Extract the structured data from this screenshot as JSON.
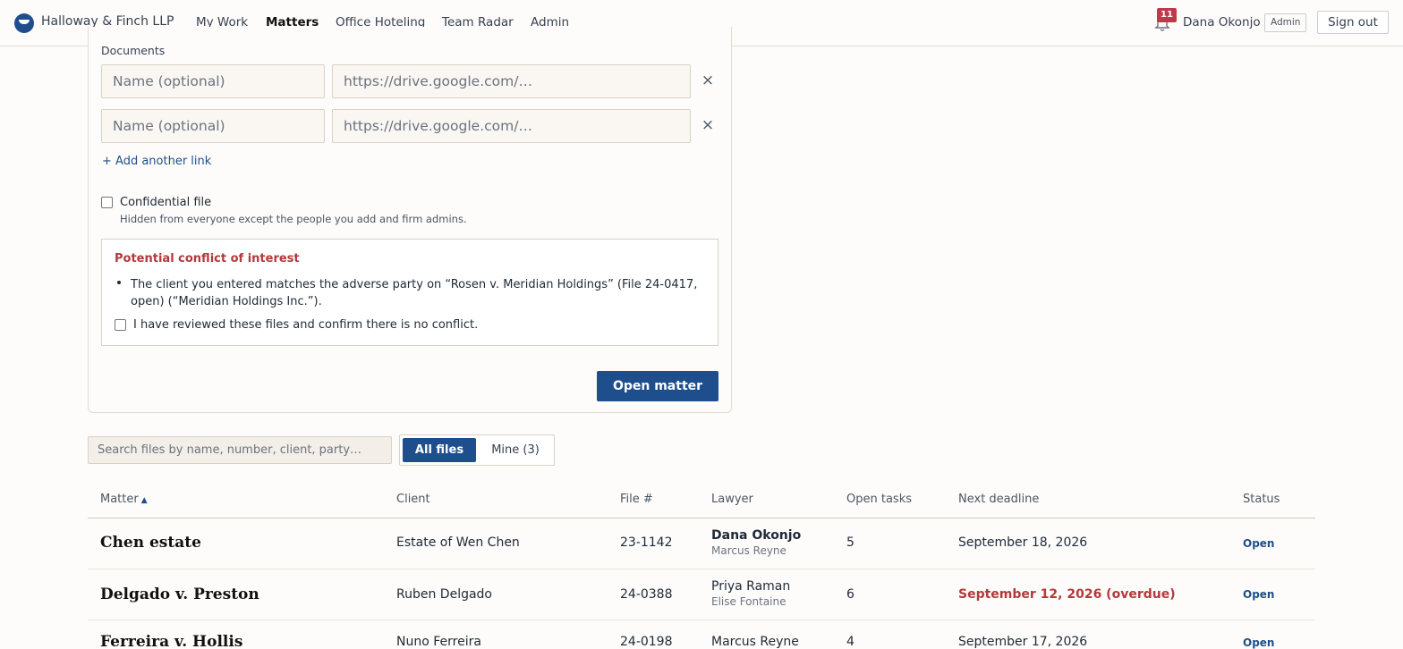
{
  "app": {
    "brand": "Halloway & Finch LLP",
    "nav": [
      "My Work",
      "Matters",
      "Office Hoteling",
      "Team Radar",
      "Admin"
    ],
    "active_nav": "Matters",
    "notifications_count": "11",
    "user_name": "Dana Okonjo",
    "user_role": "Admin",
    "sign_out": "Sign out"
  },
  "form": {
    "documents_label": "Documents",
    "doc_rows": [
      {
        "name_placeholder": "Name (optional)",
        "url_placeholder": "https://drive.google.com/…",
        "remove": "×"
      },
      {
        "name_placeholder": "Name (optional)",
        "url_placeholder": "https://drive.google.com/…",
        "remove": "×"
      }
    ],
    "add_link": "+ Add another link",
    "confidential_label": "Confidential file",
    "confidential_help": "Hidden from everyone except the people you add and firm admins.",
    "conflict_title": "Potential conflict of interest",
    "conflict_item": "The client you entered matches the adverse party on “Rosen v. Meridian Holdings” (File 24-0417, open) (“Meridian Holdings Inc.”).",
    "review_label": "I have reviewed these files and confirm there is no conflict.",
    "submit": "Open matter"
  },
  "filters": {
    "search_placeholder": "Search files by name, number, client, party…",
    "all_label": "All files",
    "mine_label": "Mine (3)"
  },
  "table": {
    "headers": [
      "Matter",
      "Client",
      "File #",
      "Lawyer",
      "Open tasks",
      "Next deadline",
      "Status"
    ],
    "sort_indicator": "▲",
    "rows": [
      {
        "matter": "Chen estate",
        "client": "Estate of Wen Chen",
        "file": "23-1142",
        "lawyer": "Dana Okonjo",
        "second_lawyer": "Marcus Reyne",
        "tasks": "5",
        "deadline": "September 18, 2026",
        "status": "Open"
      },
      {
        "matter": "Delgado v. Preston",
        "client": "Ruben Delgado",
        "file": "24-0388",
        "lawyer": "Priya Raman",
        "second_lawyer": "Elise Fontaine",
        "tasks": "6",
        "deadline": "September 12, 2026 (overdue)",
        "status": "Open"
      },
      {
        "matter": "Ferreira v. Hollis",
        "client": "Nuno Ferreira",
        "file": "24-0198",
        "lawyer": "Marcus Reyne",
        "second_lawyer": "",
        "tasks": "4",
        "deadline": "September 17, 2026",
        "status": "Open"
      }
    ]
  }
}
